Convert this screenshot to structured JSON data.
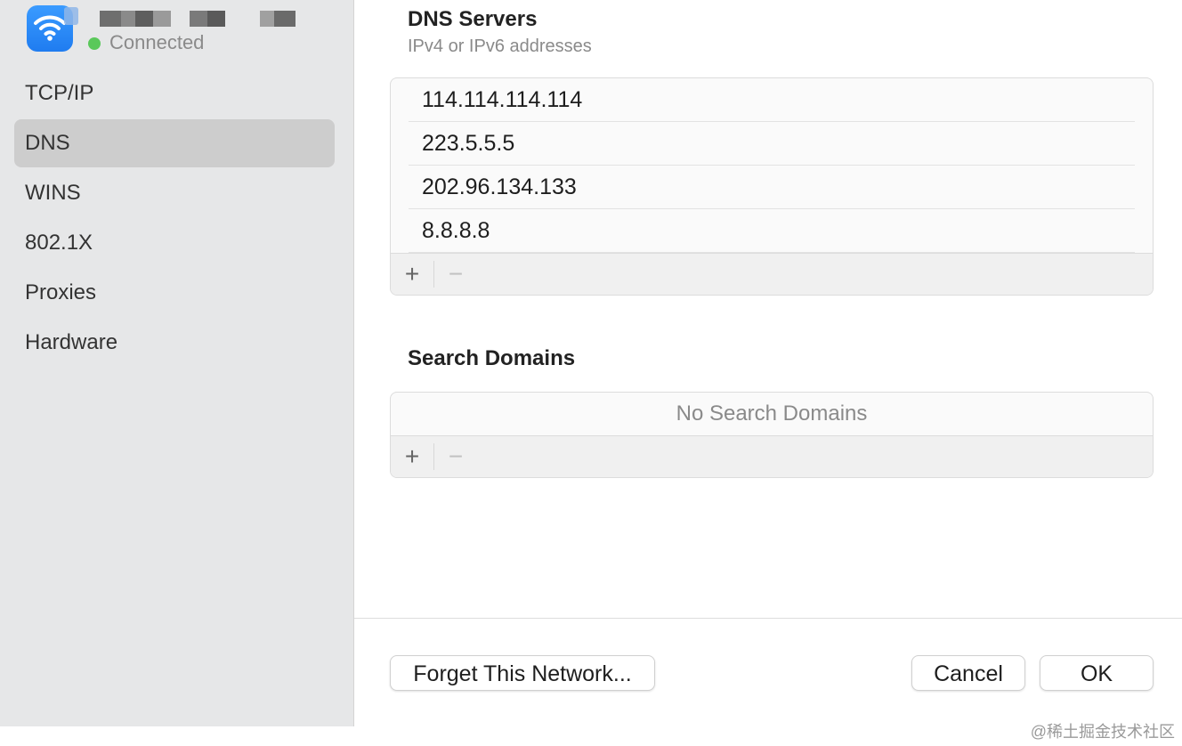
{
  "sidebar": {
    "network_status": "Connected",
    "status_color": "#5ac85a",
    "network_icon": "wifi-icon",
    "items": [
      {
        "label": "TCP/IP",
        "selected": false
      },
      {
        "label": "DNS",
        "selected": true
      },
      {
        "label": "WINS",
        "selected": false
      },
      {
        "label": "802.1X",
        "selected": false
      },
      {
        "label": "Proxies",
        "selected": false
      },
      {
        "label": "Hardware",
        "selected": false
      }
    ]
  },
  "dns": {
    "title": "DNS Servers",
    "subtitle": "IPv4 or IPv6 addresses",
    "servers": [
      "114.114.114.114",
      "223.5.5.5",
      "202.96.134.133",
      "8.8.8.8"
    ],
    "add_label": "+",
    "remove_label": "−"
  },
  "search_domains": {
    "title": "Search Domains",
    "empty_text": "No Search Domains",
    "add_label": "+",
    "remove_label": "−"
  },
  "footer": {
    "forget_label": "Forget This Network...",
    "cancel_label": "Cancel",
    "ok_label": "OK"
  },
  "watermark": "@稀土掘金技术社区"
}
